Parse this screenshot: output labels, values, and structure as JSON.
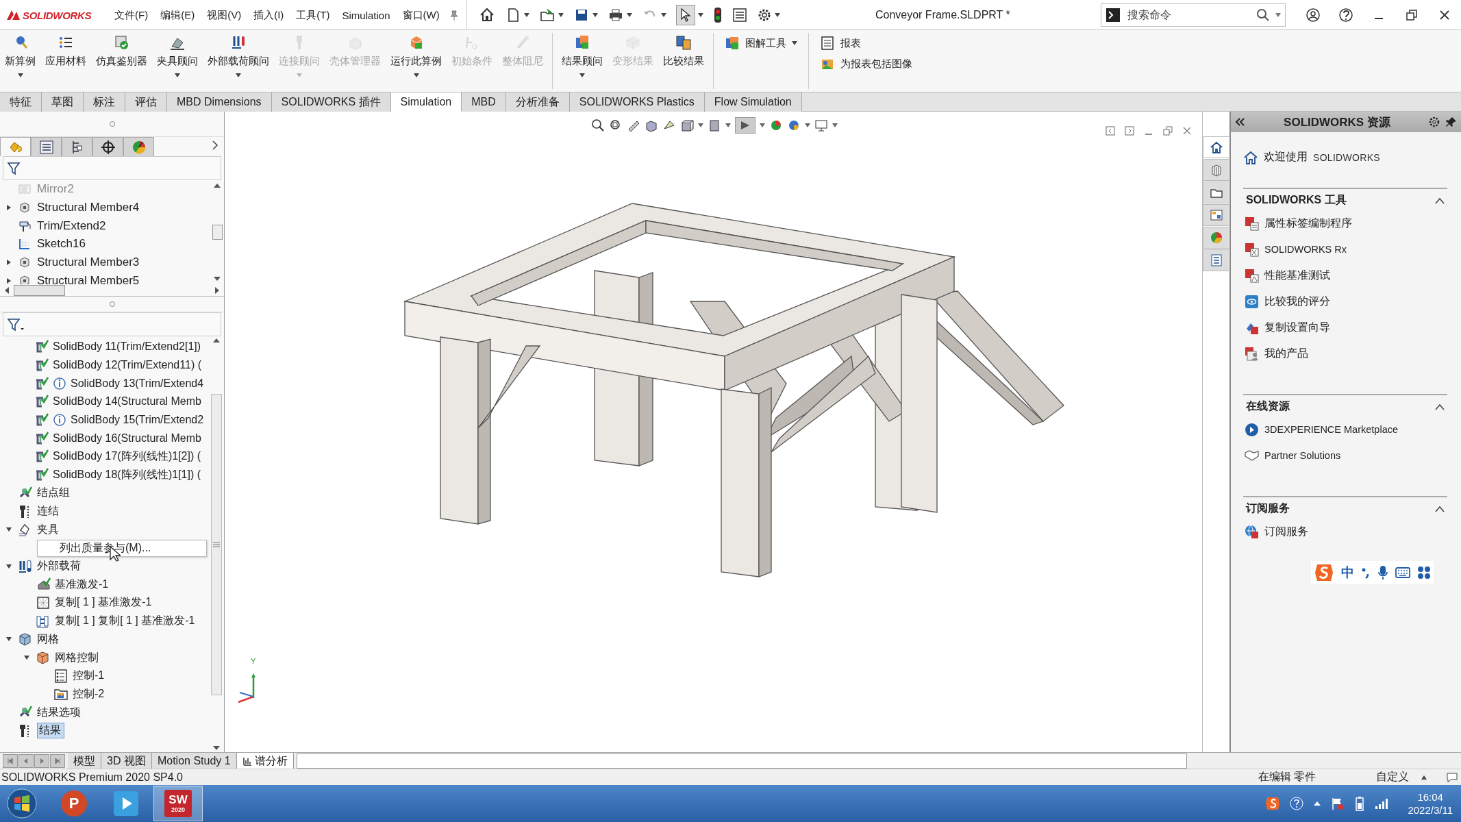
{
  "app": {
    "logo": "SOLIDWORKS"
  },
  "menu": [
    "文件(F)",
    "编辑(E)",
    "视图(V)",
    "插入(I)",
    "工具(T)",
    "Simulation",
    "窗口(W)"
  ],
  "window": {
    "title": "Conveyor Frame.SLDPRT *"
  },
  "search": {
    "placeholder": "搜索命令"
  },
  "ribbon": {
    "groups": [
      [
        {
          "label": "新算例",
          "disabled": false,
          "dropdown": true
        },
        {
          "label": "应用材料",
          "disabled": false,
          "dropdown": false
        },
        {
          "label": "仿真鉴别器",
          "disabled": false,
          "dropdown": false
        },
        {
          "label": "夹具顾问",
          "disabled": false,
          "dropdown": true
        },
        {
          "label": "外部载荷顾问",
          "disabled": false,
          "dropdown": true
        },
        {
          "label": "连接顾问",
          "disabled": true,
          "dropdown": true
        },
        {
          "label": "壳体管理器",
          "disabled": true,
          "dropdown": false
        },
        {
          "label": "运行此算例",
          "disabled": false,
          "dropdown": true
        },
        {
          "label": "初始条件",
          "disabled": true,
          "dropdown": false
        },
        {
          "label": "整体阻尼",
          "disabled": true,
          "dropdown": false
        }
      ],
      [
        {
          "label": "结果顾问",
          "disabled": false,
          "dropdown": true
        },
        {
          "label": "变形结果",
          "disabled": true,
          "dropdown": false
        },
        {
          "label": "比较结果",
          "disabled": false,
          "dropdown": false
        }
      ]
    ],
    "small_tools": [
      [
        {
          "label": "图解工具",
          "dropdown": true
        }
      ],
      [
        {
          "label": "报表",
          "dropdown": false
        },
        {
          "label": "为报表包括图像",
          "dropdown": false
        }
      ]
    ]
  },
  "command_tabs": [
    {
      "label": "特征",
      "selected": false
    },
    {
      "label": "草图",
      "selected": false
    },
    {
      "label": "标注",
      "selected": false
    },
    {
      "label": "评估",
      "selected": false
    },
    {
      "label": "MBD Dimensions",
      "selected": false
    },
    {
      "label": "SOLIDWORKS 插件",
      "selected": false
    },
    {
      "label": "Simulation",
      "selected": true
    },
    {
      "label": "MBD",
      "selected": false
    },
    {
      "label": "分析准备",
      "selected": false
    },
    {
      "label": "SOLIDWORKS Plastics",
      "selected": false
    },
    {
      "label": "Flow Simulation",
      "selected": false
    }
  ],
  "panel_tabs": [
    {
      "selected": true
    },
    {
      "selected": false
    },
    {
      "selected": false
    },
    {
      "selected": false
    },
    {
      "selected": false
    }
  ],
  "feature_tree": {
    "items": [
      {
        "label": "Mirror2",
        "collapsed": false,
        "suppressed": true
      },
      {
        "label": "Structural Member4",
        "collapsed": true,
        "suppressed": false
      },
      {
        "label": "Trim/Extend2",
        "collapsed": false,
        "suppressed": false
      },
      {
        "label": "Sketch16",
        "collapsed": false,
        "suppressed": false
      },
      {
        "label": "Structural Member3",
        "collapsed": true,
        "suppressed": false
      },
      {
        "label": "Structural Member5",
        "collapsed": true,
        "suppressed": false
      }
    ]
  },
  "study_tree": {
    "bodies": [
      {
        "label": "SolidBody 11(Trim/Extend2[1])",
        "warning": false
      },
      {
        "label": "SolidBody 12(Trim/Extend11) (",
        "warning": false
      },
      {
        "label": "SolidBody 13(Trim/Extend4",
        "warning": true
      },
      {
        "label": "SolidBody 14(Structural Memb",
        "warning": false
      },
      {
        "label": "SolidBody 15(Trim/Extend2",
        "warning": true
      },
      {
        "label": "SolidBody 16(Structural Memb",
        "warning": false
      },
      {
        "label": "SolidBody 17(阵列(线性)1[2]) (",
        "warning": false
      },
      {
        "label": "SolidBody 18(阵列(线性)1[1]) (",
        "warning": false
      }
    ],
    "items": [
      {
        "label": "结点组",
        "expanded": false,
        "selected": false
      },
      {
        "label": "连结",
        "expanded": false,
        "selected": false
      },
      {
        "label": "夹具",
        "expanded": true,
        "selected": false,
        "popup": "列出质量参与(M)..."
      },
      {
        "label": "外部载荷",
        "expanded": true,
        "selected": false,
        "children": [
          {
            "label": "基准激发-1",
            "expanded": false,
            "selected": false
          },
          {
            "label": "复制[ 1 ] 基准激发-1",
            "expanded": false,
            "selected": false
          },
          {
            "label": "复制[ 1 ] 复制[ 1 ] 基准激发-1",
            "expanded": false,
            "selected": false
          }
        ]
      },
      {
        "label": "网格",
        "expanded": true,
        "selected": false,
        "children": [
          {
            "label": "网格控制",
            "expanded": true,
            "selected": false,
            "children": [
              {
                "label": "控制-1",
                "expanded": false,
                "selected": false
              },
              {
                "label": "控制-2",
                "expanded": false,
                "selected": false
              }
            ]
          }
        ]
      },
      {
        "label": "结果选项",
        "expanded": false,
        "selected": false
      },
      {
        "label": "结果",
        "expanded": false,
        "selected": true
      }
    ]
  },
  "viewport": {
    "triad": {
      "y_label": "Y"
    }
  },
  "side_tabs": [
    {
      "selected": true
    },
    {
      "selected": false
    },
    {
      "selected": false
    },
    {
      "selected": false
    },
    {
      "selected": false
    },
    {
      "selected": false
    }
  ],
  "resource_pane": {
    "title": "SOLIDWORKS 资源",
    "welcome": {
      "label": "欢迎使用",
      "product": "SOLIDWORKS"
    },
    "sections": [
      {
        "title": "SOLIDWORKS 工具",
        "expanded": true,
        "items": [
          "属性标签编制程序",
          "SOLIDWORKS Rx",
          "性能基准测试",
          "比较我的评分",
          "复制设置向导",
          "我的产品"
        ]
      },
      {
        "title": "在线资源",
        "expanded": true,
        "items": [
          "3DEXPERIENCE Marketplace",
          "Partner Solutions"
        ]
      },
      {
        "title": "订阅服务",
        "expanded": true,
        "items": [
          "订阅服务"
        ]
      }
    ]
  },
  "ime": {
    "mode": "中"
  },
  "bottom_tabs": [
    {
      "label": "模型",
      "selected": false
    },
    {
      "label": "3D 视图",
      "selected": false
    },
    {
      "label": "Motion Study 1",
      "selected": false
    },
    {
      "label": "谱分析",
      "selected": true
    }
  ],
  "status_bar": {
    "version": "SOLIDWORKS Premium 2020 SP4.0",
    "mode": "在编辑 零件",
    "units": "自定义"
  },
  "taskbar": {
    "apps": [
      {
        "kind": "powerpoint",
        "text": "P",
        "active": false
      },
      {
        "kind": "player",
        "active": false
      },
      {
        "kind": "solidworks",
        "text": "SW",
        "badge": "2020",
        "active": true
      }
    ],
    "time": "16:04",
    "date": "2022/3/11"
  }
}
